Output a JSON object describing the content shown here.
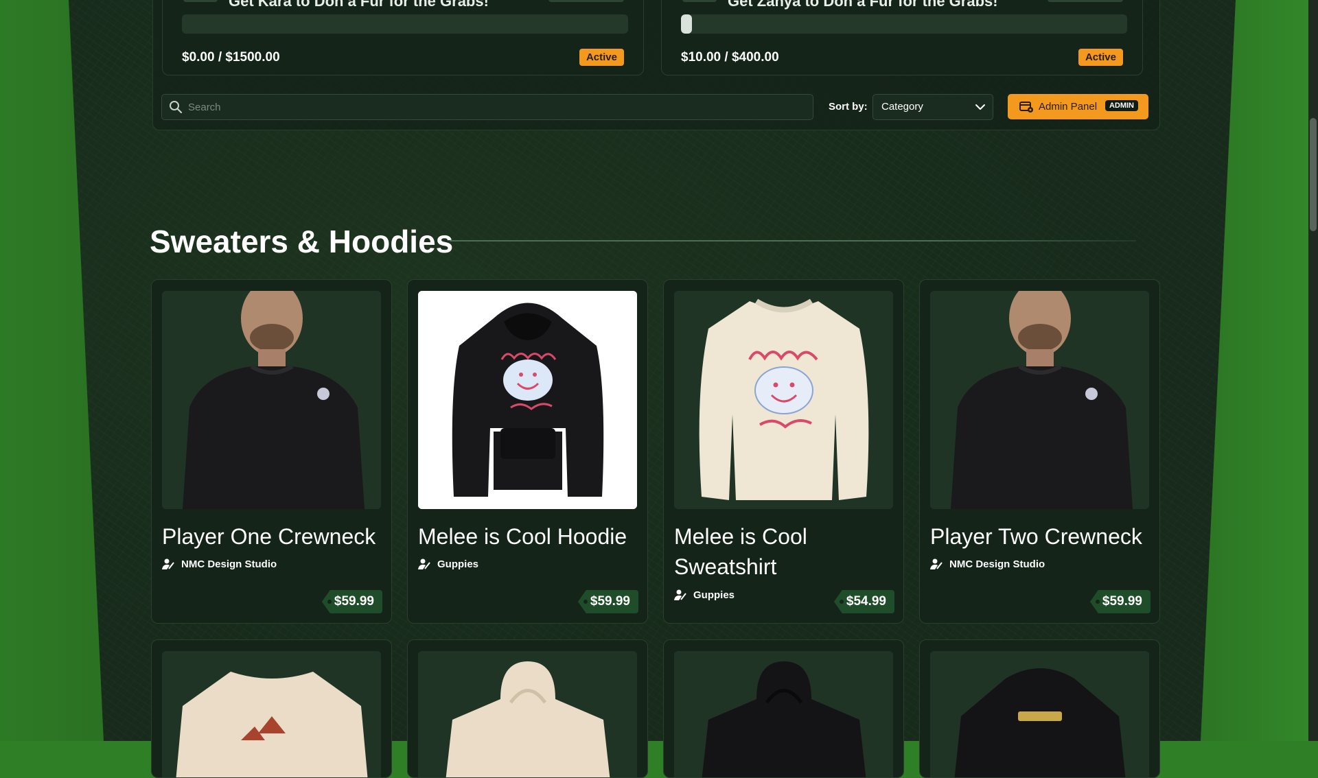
{
  "goals": [
    {
      "title": "Get Kara to Don a Fur for the Grabs!",
      "amount": "$0.00 / $1500.00",
      "status": "Active",
      "progress": 0.0
    },
    {
      "title": "Get Zanya to Don a Fur for the Grabs!",
      "amount": "$10.00 / $400.00",
      "status": "Active",
      "progress": 0.025
    }
  ],
  "search": {
    "placeholder": "Search"
  },
  "sort": {
    "label": "Sort by:",
    "value": "Category"
  },
  "admin": {
    "label": "Admin Panel",
    "badge": "ADMIN"
  },
  "section": {
    "title": "Sweaters & Hoodies"
  },
  "products": [
    {
      "title": "Player One Crewneck",
      "vendor": "NMC Design Studio",
      "price": "$59.99"
    },
    {
      "title": "Melee is Cool Hoodie",
      "vendor": "Guppies",
      "price": "$59.99"
    },
    {
      "title": "Melee is Cool Sweatshirt",
      "vendor": "Guppies",
      "price": "$54.99"
    },
    {
      "title": "Player Two Crewneck",
      "vendor": "NMC Design Studio",
      "price": "$59.99"
    }
  ],
  "colors": {
    "accent": "#f39a1e",
    "panel": "#142419",
    "price_bg": "#1f4d2a",
    "grass": "#2f7f27"
  }
}
